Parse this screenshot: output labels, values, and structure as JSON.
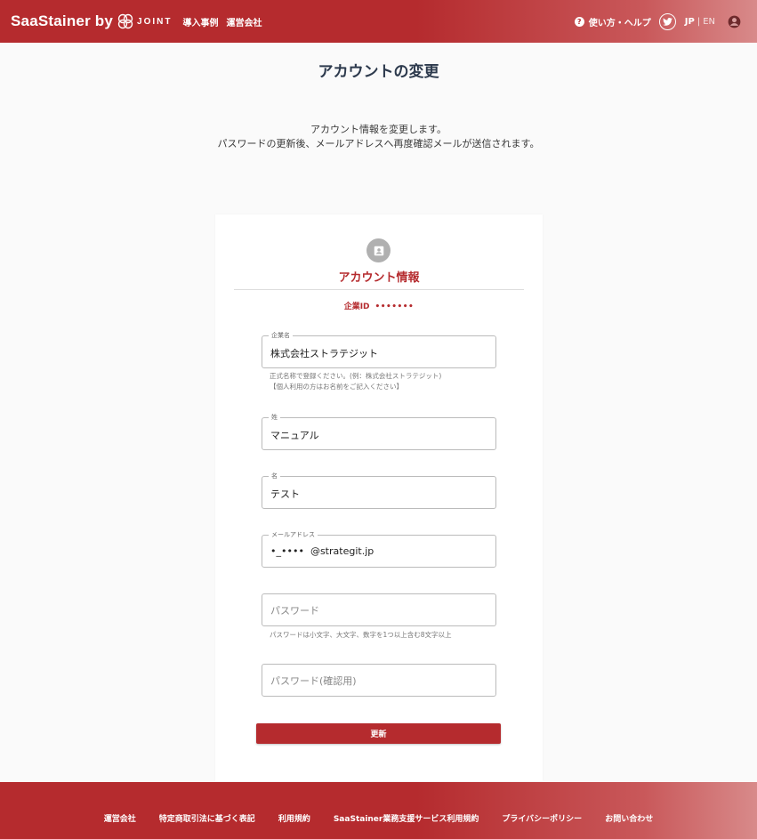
{
  "header": {
    "logo_text": "SaaStainer by",
    "logo_sub": "JOINT",
    "nav": [
      "導入事例",
      "運営会社"
    ],
    "help_label": "使い方・ヘルプ",
    "lang_jp": "JP",
    "lang_sep": "|",
    "lang_en": "EN",
    "accent_color": "#b52b2e"
  },
  "page": {
    "title": "アカウントの変更",
    "desc_line1": "アカウント情報を変更します。",
    "desc_line2": "パスワードの更新後、メールアドレスへ再度確認メールが送信されます。"
  },
  "card": {
    "title": "アカウント情報",
    "company_id_label": "企業ID",
    "company_id_value": "•••••••",
    "company_name": {
      "label": "企業名",
      "value": "株式会社ストラテジット",
      "helper1": "正式名称で登録ください。(例：株式会社ストラテジット)",
      "helper2": "【個人利用の方はお名前をご記入ください】"
    },
    "last_name": {
      "label": "姓",
      "value": "マニュアル"
    },
    "first_name": {
      "label": "名",
      "value": "テスト"
    },
    "email": {
      "label": "メールアドレス",
      "value_masked": "•_••••",
      "value_domain": "@strategit.jp"
    },
    "password": {
      "placeholder": "パスワード",
      "helper": "パスワードは小文字、大文字、数字を1つ以上含む8文字以上"
    },
    "password_confirm": {
      "placeholder": "パスワード(確認用)"
    },
    "submit_label": "更新"
  },
  "footer": {
    "links": [
      "運営会社",
      "特定商取引法に基づく表記",
      "利用規約",
      "SaaStainer業務支援サービス利用規約",
      "プライバシーポリシー",
      "お問い合わせ"
    ]
  }
}
